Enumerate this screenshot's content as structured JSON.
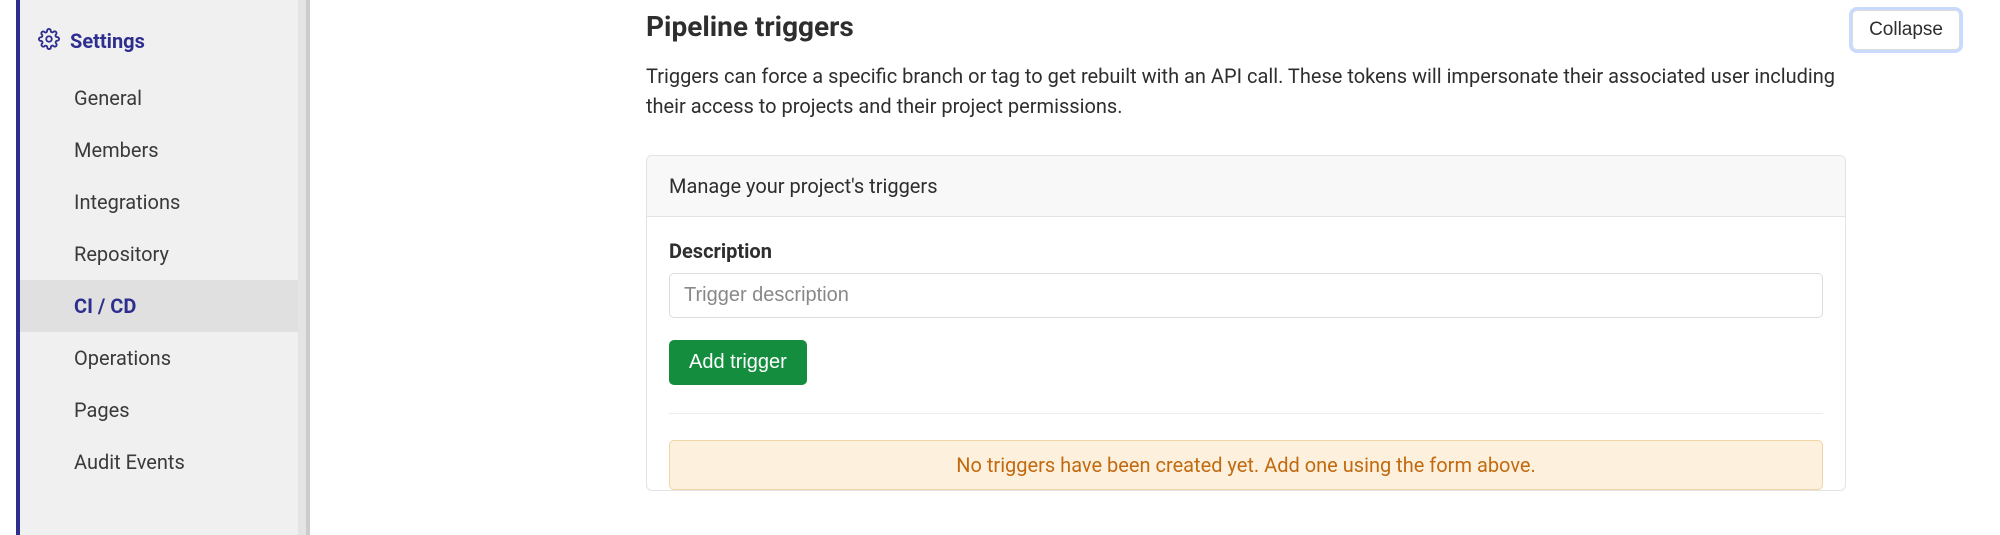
{
  "sidebar": {
    "header": "Settings",
    "items": [
      {
        "label": "General"
      },
      {
        "label": "Members"
      },
      {
        "label": "Integrations"
      },
      {
        "label": "Repository"
      },
      {
        "label": "CI / CD"
      },
      {
        "label": "Operations"
      },
      {
        "label": "Pages"
      },
      {
        "label": "Audit Events"
      }
    ]
  },
  "main": {
    "section_title": "Pipeline triggers",
    "section_desc": "Triggers can force a specific branch or tag to get rebuilt with an API call. These tokens will impersonate their associated user including their access to projects and their project permissions.",
    "collapse_label": "Collapse",
    "panel_header": "Manage your project's triggers",
    "form": {
      "description_label": "Description",
      "description_placeholder": "Trigger description",
      "add_button_label": "Add trigger"
    },
    "empty_message": "No triggers have been created yet. Add one using the form above."
  }
}
